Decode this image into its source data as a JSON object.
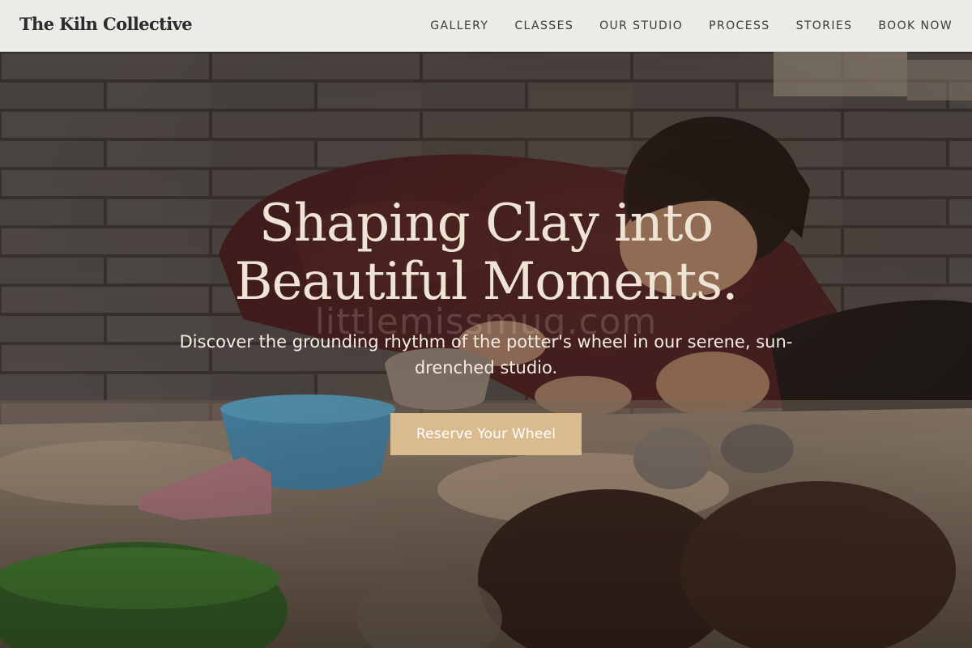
{
  "header": {
    "brand": "The Kiln Collective",
    "nav": [
      {
        "label": "GALLERY"
      },
      {
        "label": "CLASSES"
      },
      {
        "label": "OUR STUDIO"
      },
      {
        "label": "PROCESS"
      },
      {
        "label": "STORIES"
      },
      {
        "label": "BOOK NOW"
      }
    ]
  },
  "hero": {
    "title_line1": "Shaping Clay into",
    "title_line2": "Beautiful Moments.",
    "subtitle": "Discover the grounding rhythm of the potter's wheel in our serene, sun-drenched studio.",
    "cta_label": "Reserve Your Wheel",
    "watermark": "littlemissmug.com"
  },
  "colors": {
    "header_bg": "#ecebe8",
    "title": "#efe4d4",
    "cta_bg": "#d9bb90",
    "cta_text": "#ffffff"
  }
}
